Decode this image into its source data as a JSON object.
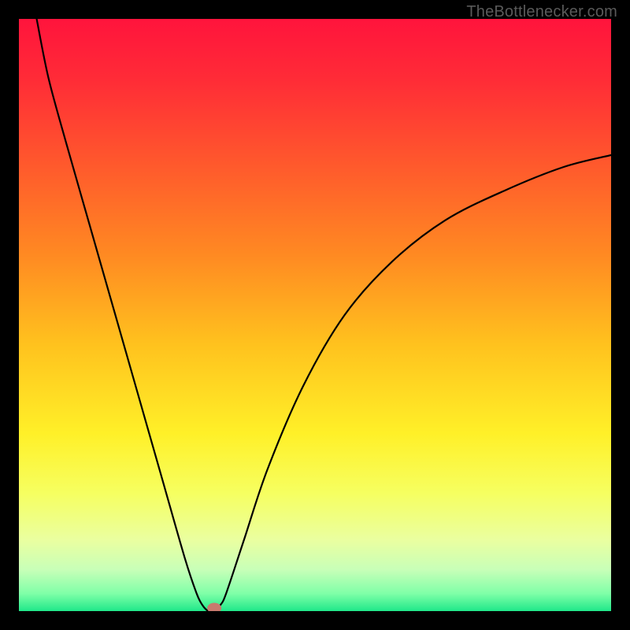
{
  "watermark": "TheBottlenecker.com",
  "chart_data": {
    "type": "line",
    "title": "",
    "xlabel": "",
    "ylabel": "",
    "xlim": [
      0,
      100
    ],
    "ylim": [
      0,
      100
    ],
    "gradient_stops": [
      {
        "offset": 0.0,
        "color": "#ff143c"
      },
      {
        "offset": 0.1,
        "color": "#ff2b37"
      },
      {
        "offset": 0.25,
        "color": "#ff5a2c"
      },
      {
        "offset": 0.4,
        "color": "#ff8a22"
      },
      {
        "offset": 0.55,
        "color": "#ffc21e"
      },
      {
        "offset": 0.7,
        "color": "#fff028"
      },
      {
        "offset": 0.8,
        "color": "#f6ff60"
      },
      {
        "offset": 0.88,
        "color": "#eaffa0"
      },
      {
        "offset": 0.93,
        "color": "#c8ffb8"
      },
      {
        "offset": 0.97,
        "color": "#80ffa8"
      },
      {
        "offset": 1.0,
        "color": "#20e88a"
      }
    ],
    "series": [
      {
        "name": "bottleneck-curve",
        "x": [
          3,
          5,
          8,
          12,
          16,
          20,
          24,
          28,
          30,
          31,
          32,
          33,
          34,
          35,
          38,
          42,
          48,
          55,
          63,
          72,
          82,
          92,
          100
        ],
        "y": [
          100,
          90,
          79,
          65,
          51,
          37,
          23,
          9,
          3,
          1,
          0,
          0,
          1,
          3,
          12,
          24,
          38,
          50,
          59,
          66,
          71,
          75,
          77
        ]
      }
    ],
    "marker": {
      "x": 33,
      "y": 0.5,
      "rx": 1.2,
      "ry": 0.9,
      "color": "#c97a6e"
    }
  }
}
